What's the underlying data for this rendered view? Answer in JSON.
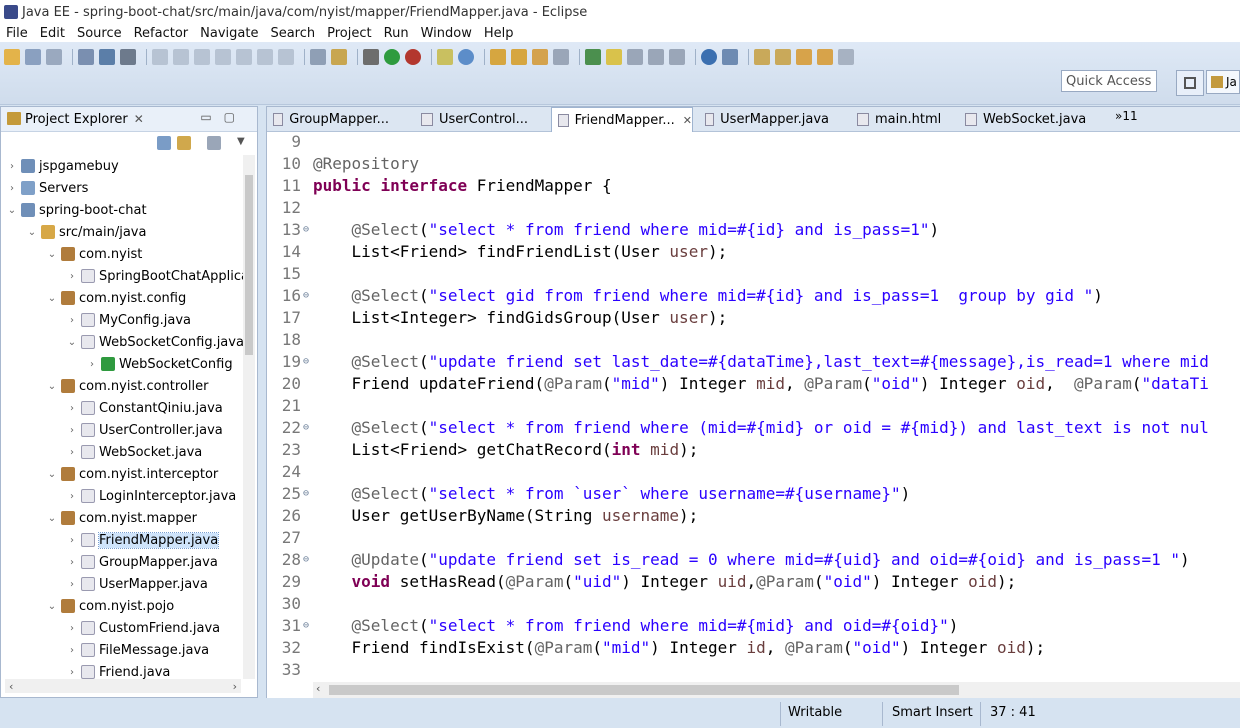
{
  "window": {
    "title": "Java EE - spring-boot-chat/src/main/java/com/nyist/mapper/FriendMapper.java - Eclipse"
  },
  "menu": [
    "File",
    "Edit",
    "Source",
    "Refactor",
    "Navigate",
    "Search",
    "Project",
    "Run",
    "Window",
    "Help"
  ],
  "toolbar": {
    "quick_access": "Quick Access",
    "perspective_label": "Ja"
  },
  "explorer": {
    "title": "Project Explorer",
    "nodes": [
      {
        "label": "jspgamebuy"
      },
      {
        "label": "Servers"
      },
      {
        "label": "spring-boot-chat"
      },
      {
        "label": "src/main/java"
      },
      {
        "label": "com.nyist"
      },
      {
        "label": "SpringBootChatApplica"
      },
      {
        "label": "com.nyist.config"
      },
      {
        "label": "MyConfig.java"
      },
      {
        "label": "WebSocketConfig.java"
      },
      {
        "label": "WebSocketConfig"
      },
      {
        "label": "com.nyist.controller"
      },
      {
        "label": "ConstantQiniu.java"
      },
      {
        "label": "UserController.java"
      },
      {
        "label": "WebSocket.java"
      },
      {
        "label": "com.nyist.interceptor"
      },
      {
        "label": "LoginInterceptor.java"
      },
      {
        "label": "com.nyist.mapper"
      },
      {
        "label": "FriendMapper.java"
      },
      {
        "label": "GroupMapper.java"
      },
      {
        "label": "UserMapper.java"
      },
      {
        "label": "com.nyist.pojo"
      },
      {
        "label": "CustomFriend.java"
      },
      {
        "label": "FileMessage.java"
      },
      {
        "label": "Friend.java"
      }
    ]
  },
  "editor": {
    "tabs": [
      "GroupMapper...",
      "UserControl...",
      "FriendMapper...",
      "UserMapper.java",
      "main.html",
      "WebSocket.java"
    ],
    "overflow": "»11",
    "line_numbers": [
      "9",
      "10",
      "11",
      "12",
      "13",
      "14",
      "15",
      "16",
      "17",
      "18",
      "19",
      "20",
      "21",
      "22",
      "23",
      "24",
      "25",
      "26",
      "27",
      "28",
      "29",
      "30",
      "31",
      "32",
      "33"
    ],
    "lines": [
      "",
      "@Repository",
      "public interface FriendMapper {",
      "",
      "    @Select(\"select * from friend where mid=#{id} and is_pass=1\")",
      "    List<Friend> findFriendList(User user);",
      "",
      "    @Select(\"select gid from friend where mid=#{id} and is_pass=1  group by gid \")",
      "    List<Integer> findGidsGroup(User user);",
      "",
      "    @Select(\"update friend set last_date=#{dataTime},last_text=#{message},is_read=1 where mid",
      "    Friend updateFriend(@Param(\"mid\") Integer mid, @Param(\"oid\") Integer oid,  @Param(\"dataTi",
      "",
      "    @Select(\"select * from friend where (mid=#{mid} or oid = #{mid}) and last_text is not nul",
      "    List<Friend> getChatRecord(int mid);",
      "",
      "    @Select(\"select * from `user` where username=#{username}\")",
      "    User getUserByName(String username);",
      "",
      "    @Update(\"update friend set is_read = 0 where mid=#{uid} and oid=#{oid} and is_pass=1 \")",
      "    void setHasRead(@Param(\"uid\") Integer uid,@Param(\"oid\") Integer oid);",
      "",
      "    @Select(\"select * from friend where mid=#{mid} and oid=#{oid}\")",
      "    Friend findIsExist(@Param(\"mid\") Integer id, @Param(\"oid\") Integer oid);",
      ""
    ]
  },
  "status": {
    "writable": "Writable",
    "insert_mode": "Smart Insert",
    "position": "37 : 41"
  }
}
